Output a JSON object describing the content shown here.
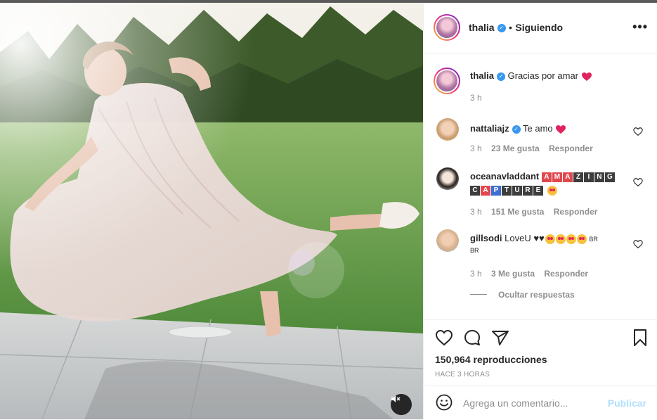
{
  "post": {
    "author": "thalia",
    "following_label": "Siguiendo",
    "dot": "•",
    "more_label": "•••"
  },
  "caption": {
    "user": "thalia",
    "text": "Gracias por amar",
    "time": "3 h"
  },
  "comments": [
    {
      "user": "nattaliajz",
      "text": "Te amo",
      "time": "3 h",
      "likes": "23 Me gusta",
      "reply": "Responder"
    },
    {
      "user": "oceanavladdant",
      "tiles_row1": [
        "A",
        "M",
        "A",
        "Z",
        "I",
        "N",
        "G"
      ],
      "tiles_row2": [
        "C",
        "A",
        "P",
        "T",
        "U",
        "R",
        "E"
      ],
      "time": "3 h",
      "likes": "151 Me gusta",
      "reply": "Responder"
    },
    {
      "user": "gillsodi",
      "text": "LoveU ♥♥",
      "tail": "BR",
      "tail2": "BR",
      "time": "3 h",
      "likes": "3 Me gusta",
      "reply": "Responder"
    }
  ],
  "hide_replies": "Ocultar respuestas",
  "stats": {
    "views": "150,964 reproducciones",
    "posted": "HACE 3 HORAS"
  },
  "composer": {
    "placeholder": "Agrega un comentario...",
    "publish": "Publicar"
  },
  "colors": {
    "verified": "#3897f0",
    "publish_disabled": "#b2dffc",
    "muted_text": "#8e8e8e",
    "heart_red": "#e0245e"
  },
  "icons": {
    "like": "heart-icon",
    "comment": "comment-bubble-icon",
    "share": "paper-plane-icon",
    "save": "bookmark-icon",
    "emoji": "smiley-icon",
    "mute": "speaker-muted-icon",
    "more": "more-options-icon"
  }
}
